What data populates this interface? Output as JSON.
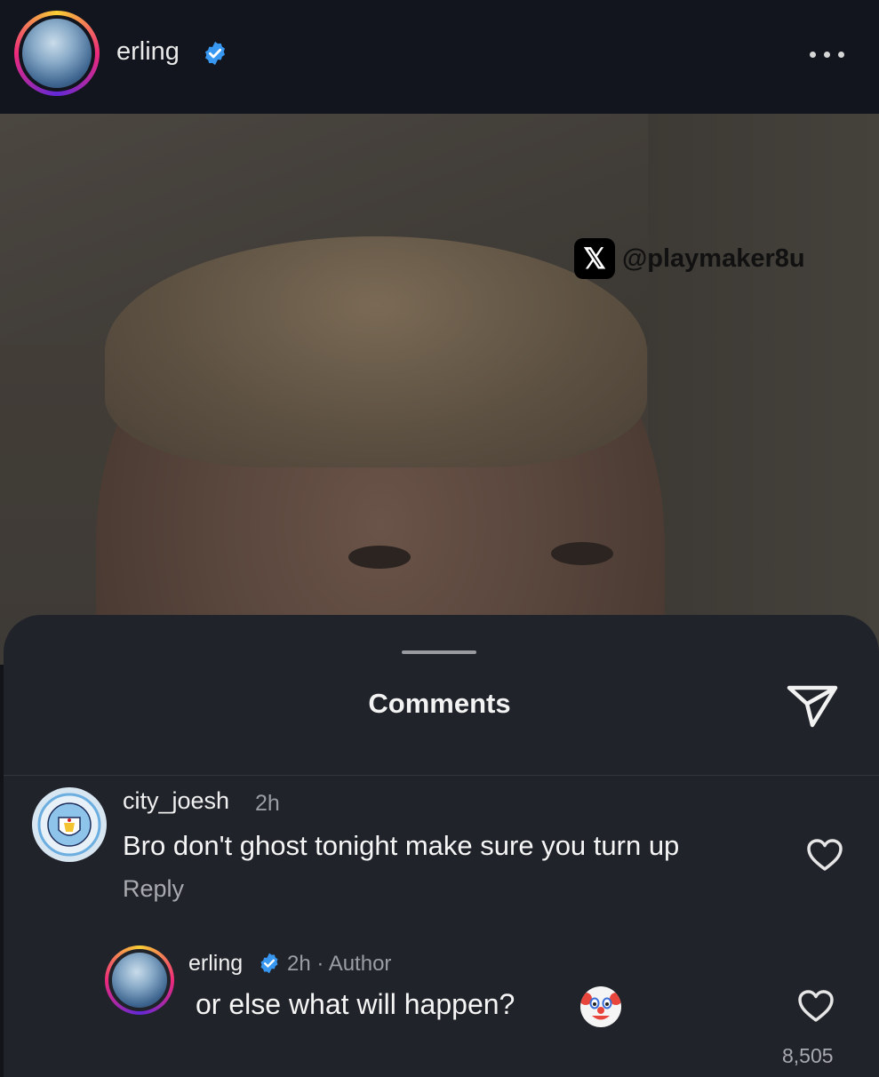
{
  "header": {
    "username": "erling",
    "verified": true,
    "more_icon": "more-horizontal-icon"
  },
  "post": {
    "watermark_platform_icon": "x-logo-icon",
    "watermark_handle": "@playmaker8u"
  },
  "comments_sheet": {
    "title": "Comments",
    "share_icon": "send-icon"
  },
  "comments": [
    {
      "username": "city_joesh",
      "time": "2h",
      "text": "Bro don't ghost tonight make sure you turn up",
      "reply_label": "Reply",
      "avatar_icon": "manchester-city-badge-icon",
      "like_icon": "heart-icon"
    }
  ],
  "reply": {
    "username": "erling",
    "verified": true,
    "meta": "2h · Author",
    "text": "or else what will happen?",
    "emoji": "clown-face-icon",
    "like_icon": "heart-icon",
    "like_count": "8,505"
  },
  "colors": {
    "verified_blue": "#3897f0",
    "sheet_background": "#21232a",
    "header_background": "#12151d"
  }
}
